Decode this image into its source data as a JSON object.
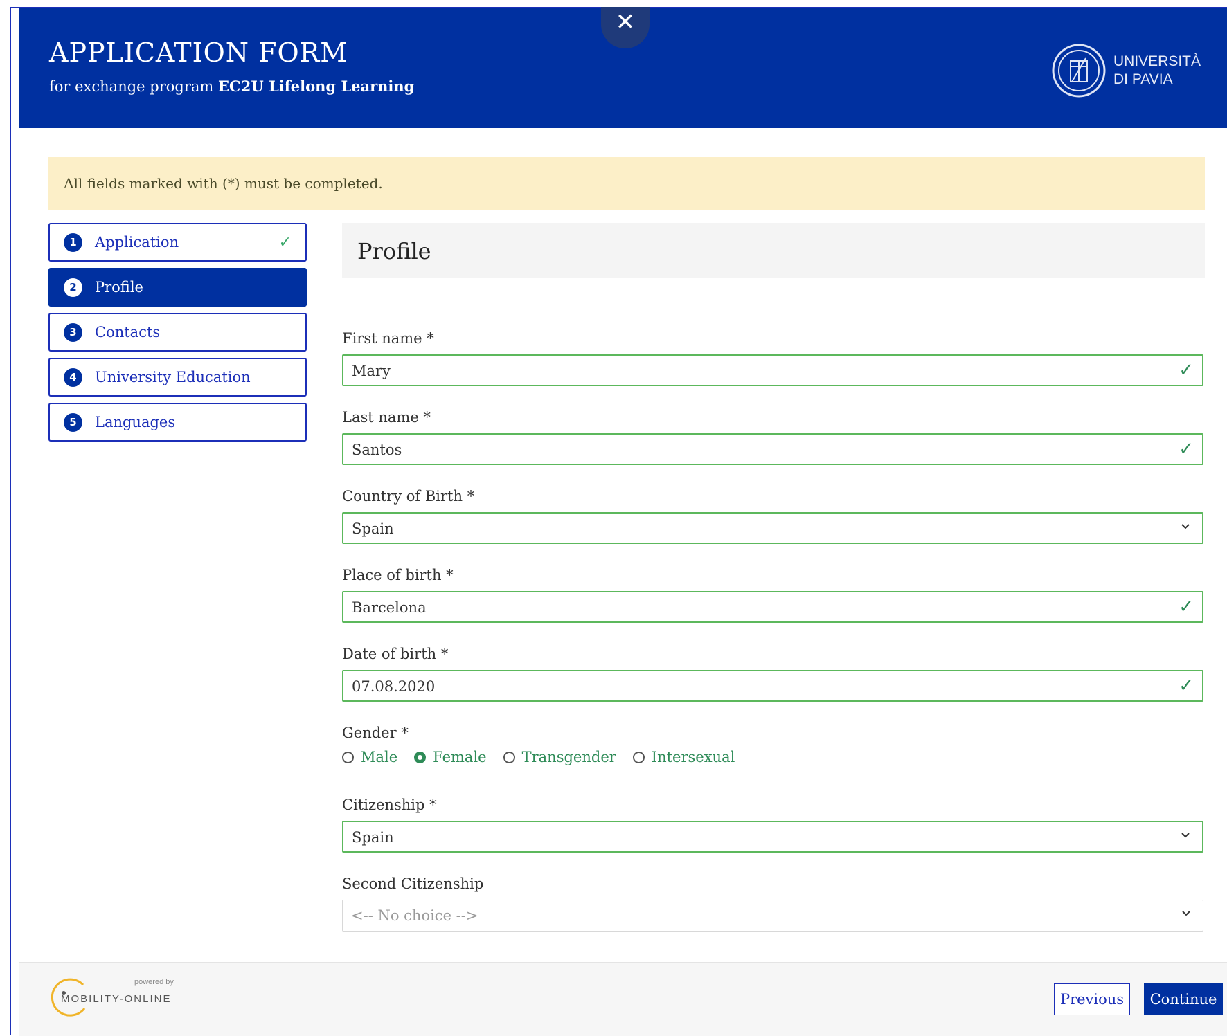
{
  "header": {
    "title": "APPLICATION FORM",
    "subtitle_prefix": "for exchange program",
    "subtitle_program": "EC2U Lifelong Learning",
    "close_label": "✕",
    "logo_line1": "UNIVERSITÀ",
    "logo_line2": "DI PAVIA"
  },
  "notice": "All fields marked with (*) must be completed.",
  "steps": [
    {
      "num": "1",
      "label": "Application",
      "done": true
    },
    {
      "num": "2",
      "label": "Profile",
      "active": true
    },
    {
      "num": "3",
      "label": "Contacts"
    },
    {
      "num": "4",
      "label": "University Education"
    },
    {
      "num": "5",
      "label": "Languages"
    }
  ],
  "section_title": "Profile",
  "form": {
    "first_name": {
      "label": "First name *",
      "value": "Mary"
    },
    "last_name": {
      "label": "Last name *",
      "value": "Santos"
    },
    "country_of_birth": {
      "label": "Country of Birth *",
      "value": "Spain"
    },
    "place_of_birth": {
      "label": "Place of birth *",
      "value": "Barcelona"
    },
    "date_of_birth": {
      "label": "Date of birth *",
      "value": "07.08.2020"
    },
    "gender": {
      "label": "Gender *",
      "options": [
        "Male",
        "Female",
        "Transgender",
        "Intersexual"
      ],
      "selected": "Female"
    },
    "citizenship": {
      "label": "Citizenship *",
      "value": "Spain"
    },
    "second_citizenship": {
      "label": "Second Citizenship",
      "value": "<-- No choice -->"
    }
  },
  "footer": {
    "powered_by": "powered by",
    "brand": "MOBILITY-ONLINE",
    "previous_label": "Previous",
    "continue_label": "Continue"
  },
  "colors": {
    "primary": "#0030a0",
    "valid": "#5cb85c",
    "notice_bg": "#fcefc8"
  }
}
